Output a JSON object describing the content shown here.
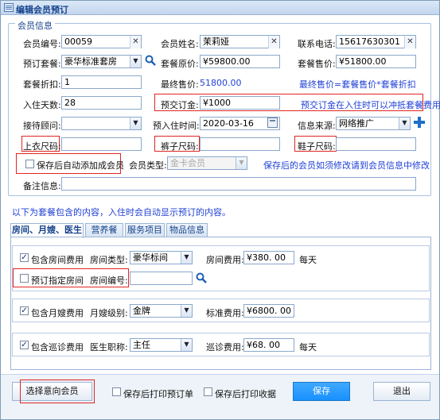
{
  "window": {
    "title": "编辑会员预订",
    "close": "✕"
  },
  "member_section": {
    "legend": "会员信息",
    "member_no": {
      "label": "会员编号:",
      "value": "00059"
    },
    "member_name": {
      "label": "会员姓名:",
      "value": "茉莉娅"
    },
    "phone": {
      "label": "联系电话:",
      "value": "15617630301"
    },
    "package": {
      "label": "预订套餐:",
      "value": "豪华标准套房"
    },
    "package_original_price": {
      "label": "套餐原价:",
      "value": "¥59800.00"
    },
    "package_sale_price": {
      "label": "套餐售价:",
      "value": "¥51800.00"
    },
    "discount": {
      "label": "套餐折扣:",
      "value": "1"
    },
    "final_price": {
      "label": "最终售价:",
      "value": "51800.00"
    },
    "final_price_formula": "最终售价=套餐售价*套餐折扣",
    "stay_days": {
      "label": "入住天数:",
      "value": "28"
    },
    "deposit": {
      "label": "预交订金:",
      "value": "¥1000"
    },
    "deposit_note": "预交订金在入住时可以冲抵套餐费用",
    "consultant": {
      "label": "接待顾问:",
      "value": ""
    },
    "checkin_date": {
      "label": "预入住时间:",
      "value": "2020-03-16"
    },
    "source": {
      "label": "信息来源:",
      "value": "网络推广"
    },
    "top_size": {
      "label": "上衣尺码:",
      "value": ""
    },
    "pants_size": {
      "label": "裤子尺码:",
      "value": ""
    },
    "shoe_size": {
      "label": "鞋子尺码:",
      "value": ""
    },
    "auto_add_member": {
      "label": "保存后自动添加成会员",
      "checked": false
    },
    "member_type": {
      "label": "会员类型:",
      "value": "金卡会员"
    },
    "member_note": "保存后的会员如须修改请到会员信息中修改",
    "remark": {
      "label": "备注信息:",
      "value": ""
    }
  },
  "package_hint": "以下为套餐包含的内容，入住时会自动显示预订的内容。",
  "tabs": [
    {
      "label": "房间、月嫂、医生",
      "active": true
    },
    {
      "label": "营养餐",
      "active": false
    },
    {
      "label": "服务项目",
      "active": false
    },
    {
      "label": "物品信息",
      "active": false
    }
  ],
  "room": {
    "include": {
      "label": "包含房间费用",
      "checked": true
    },
    "type": {
      "label": "房间类型:",
      "value": "豪华标间"
    },
    "fee": {
      "label": "房间费用:",
      "value": "¥380. 00"
    },
    "unit": "每天",
    "reserve_room": {
      "label": "预订指定房间",
      "checked": false
    },
    "room_no": {
      "label": "房间编号:",
      "value": ""
    }
  },
  "nanny": {
    "include": {
      "label": "包含月嫂费用",
      "checked": true
    },
    "level": {
      "label": "月嫂级别:",
      "value": "金牌"
    },
    "fee": {
      "label": "标准费用:",
      "value": "¥6800. 00"
    }
  },
  "doctor": {
    "include": {
      "label": "包含巡诊费用",
      "checked": true
    },
    "title": {
      "label": "医生职称:",
      "value": "主任"
    },
    "fee": {
      "label": "巡诊费用:",
      "value": "¥68. 00"
    },
    "unit": "每天"
  },
  "footer": {
    "select_member": "选择意向会员",
    "print_order": {
      "label": "保存后打印预订单",
      "checked": false
    },
    "print_receipt": {
      "label": "保存后打印收据",
      "checked": false
    },
    "save": "保存",
    "exit": "退出"
  },
  "colors": {
    "accent": "#1f3fd6",
    "highlight_border": "#e02424",
    "save_button": "#1890ff"
  }
}
